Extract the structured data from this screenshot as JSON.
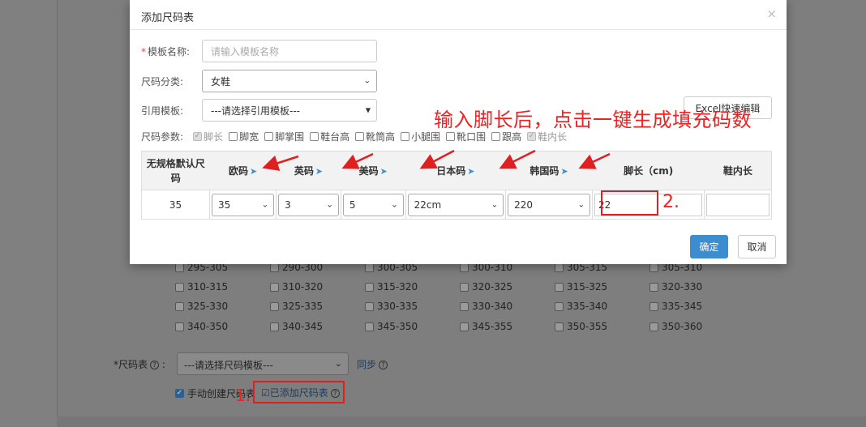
{
  "background": {
    "range_rows": [
      [
        "295-305",
        "290-300",
        "300-305",
        "300-310",
        "305-315",
        "305-310"
      ],
      [
        "310-315",
        "310-320",
        "315-320",
        "320-325",
        "315-325",
        "320-330"
      ],
      [
        "325-330",
        "325-335",
        "330-335",
        "330-340",
        "335-340",
        "335-345"
      ],
      [
        "340-350",
        "340-345",
        "345-350",
        "345-355",
        "350-355",
        "350-360"
      ]
    ],
    "size_table_label": "*尺码表",
    "size_table_select": "---请选择尺码模板---",
    "sync_link": "同步",
    "manual_create_label": "手动创建尺码表",
    "added_link": "已添加尺码表"
  },
  "modal": {
    "title": "添加尺码表",
    "close": "×",
    "template_name_label": "模板名称:",
    "template_name_placeholder": "请输入模板名称",
    "category_label": "尺码分类:",
    "category_value": "女鞋",
    "ref_template_label": "引用模板:",
    "ref_template_value": "---请选择引用模板---",
    "excel_button": "Excel快速编辑",
    "params_label": "尺码参数:",
    "params": [
      {
        "label": "脚长",
        "checked": true,
        "disabled": true
      },
      {
        "label": "脚宽",
        "checked": false,
        "disabled": false
      },
      {
        "label": "脚掌围",
        "checked": false,
        "disabled": false
      },
      {
        "label": "鞋台高",
        "checked": false,
        "disabled": false
      },
      {
        "label": "靴筒高",
        "checked": false,
        "disabled": false
      },
      {
        "label": "小腿围",
        "checked": false,
        "disabled": false
      },
      {
        "label": "靴口围",
        "checked": false,
        "disabled": false
      },
      {
        "label": "跟高",
        "checked": false,
        "disabled": false
      },
      {
        "label": "鞋内长",
        "checked": true,
        "disabled": true
      }
    ],
    "table": {
      "headers": [
        "无规格默认尺码",
        "欧码",
        "英码",
        "美码",
        "日本码",
        "韩国码",
        "脚长（cm)",
        "鞋内长"
      ],
      "row": {
        "default_size": "35",
        "eu": "35",
        "uk": "3",
        "us": "5",
        "jp": "22cm",
        "kr": "220",
        "foot_length": "22",
        "inner_length": ""
      }
    },
    "confirm_button": "确定",
    "cancel_button": "取消"
  },
  "annotations": {
    "instruction": "输入脚长后，点击一键生成填充码数",
    "step1": "1.",
    "step2": "2.",
    "color": "#e02020"
  }
}
